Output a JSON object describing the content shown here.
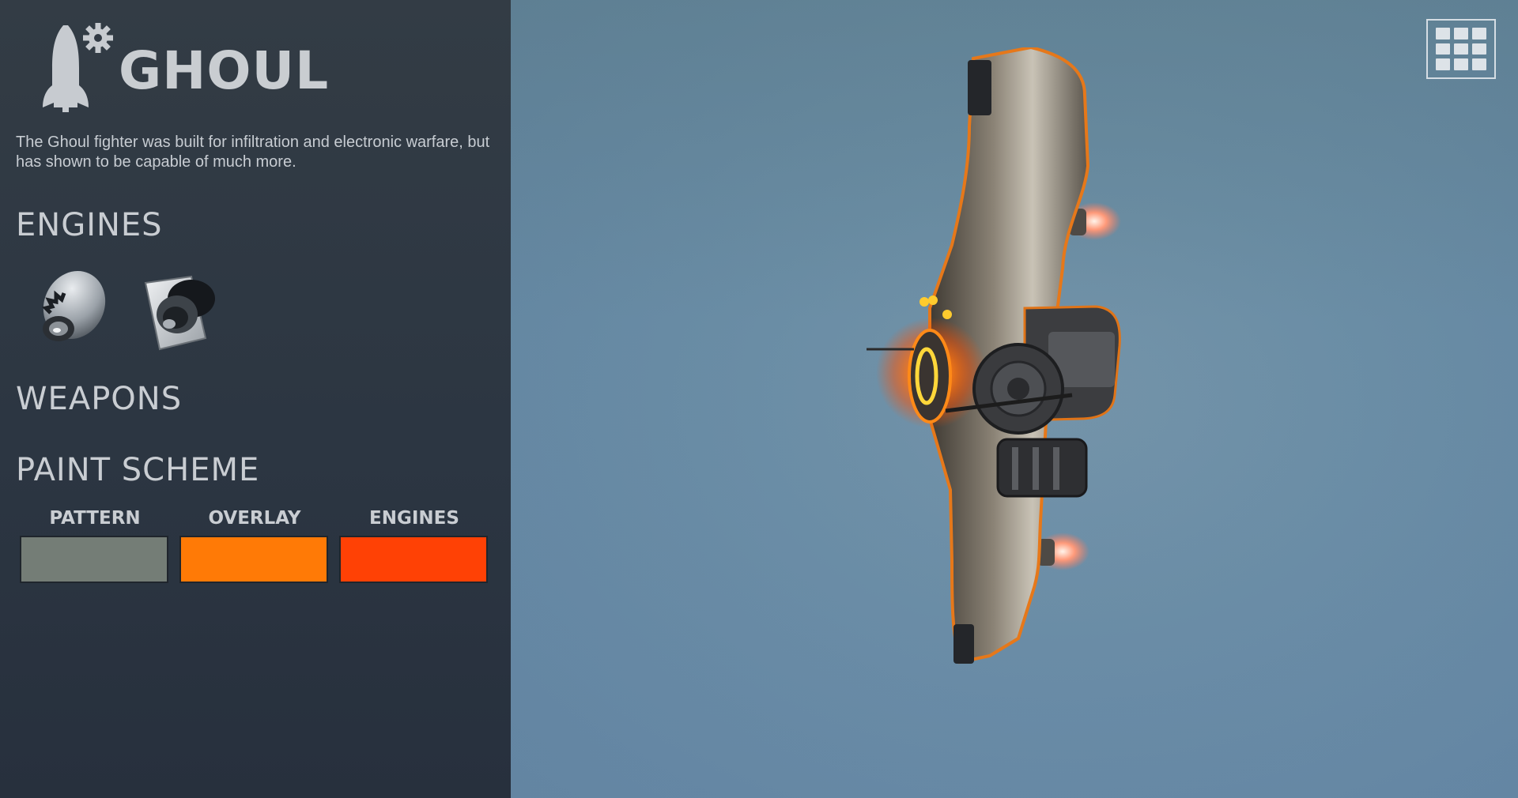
{
  "ship": {
    "name": "GHOUL",
    "description": "The Ghoul fighter was built for infiltration and electronic warfare, but has shown to be capable of much more.",
    "icon": "rocket-gear-icon"
  },
  "sections": {
    "engines": "ENGINES",
    "weapons": "WEAPONS",
    "paint_scheme": "PAINT SCHEME"
  },
  "engines": [
    {
      "icon": "round-thruster-engine-icon"
    },
    {
      "icon": "square-thruster-engine-icon"
    }
  ],
  "paint": [
    {
      "label": "PATTERN",
      "color": "#747d76"
    },
    {
      "label": "OVERLAY",
      "color": "#ff7a06"
    },
    {
      "label": "ENGINES",
      "color": "#ff4105"
    }
  ],
  "viewport": {
    "menu_icon": "grid-menu-icon"
  }
}
